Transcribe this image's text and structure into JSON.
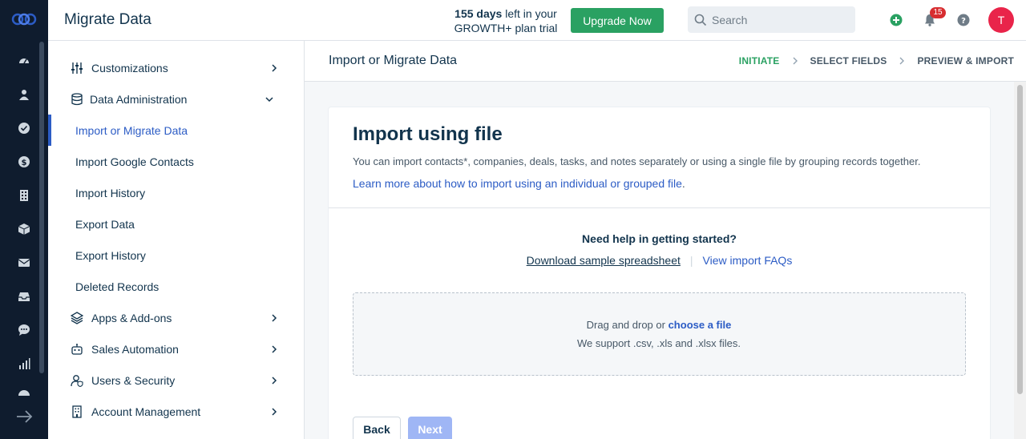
{
  "topbar": {
    "title": "Migrate Data",
    "trial_days": "155 days",
    "trial_line1_rest": " left in your",
    "trial_line2": "GROWTH+ plan trial",
    "upgrade_label": "Upgrade Now",
    "search_placeholder": "Search",
    "notification_count": "15",
    "avatar_initial": "T"
  },
  "rail": {
    "icons": [
      "dashboard-icon",
      "contacts-icon",
      "tasks-icon",
      "deals-icon",
      "companies-icon",
      "products-icon",
      "email-icon",
      "inbox-icon",
      "chat-icon",
      "reports-icon"
    ]
  },
  "sidebar": {
    "items": [
      {
        "label": "Customizations",
        "icon": "sliders-icon"
      },
      {
        "label": "Data Administration",
        "icon": "database-icon"
      },
      {
        "label": "Import or Migrate Data"
      },
      {
        "label": "Import Google Contacts"
      },
      {
        "label": "Import History"
      },
      {
        "label": "Export Data"
      },
      {
        "label": "Export History"
      },
      {
        "label": "Deleted Records"
      },
      {
        "label": "Apps & Add-ons",
        "icon": "layers-icon"
      },
      {
        "label": "Sales Automation",
        "icon": "robot-icon"
      },
      {
        "label": "Users & Security",
        "icon": "user-shield-icon"
      },
      {
        "label": "Account Management",
        "icon": "building-icon"
      }
    ]
  },
  "content": {
    "header_title": "Import or Migrate Data",
    "steps": [
      "INITIATE",
      "SELECT FIELDS",
      "PREVIEW & IMPORT"
    ],
    "current_step": "INITIATE"
  },
  "card": {
    "title": "Import using file",
    "description": "You can import contacts*, companies, deals, tasks, and notes separately or using a single file by grouping records together.",
    "learn_more": "Learn more about how to import using an individual or grouped file",
    "learn_more_end": ".",
    "help_title": "Need help in getting started?",
    "download_link": "Download sample spreadsheet",
    "separator": "|",
    "faq_link": "View import FAQs",
    "drop_text": "Drag and drop or ",
    "choose_file": "choose a file",
    "support_text": "We support .csv, .xls and .xlsx files.",
    "back_label": "Back",
    "next_label": "Next"
  },
  "colors": {
    "rail_bg": "#0f1c2e",
    "accent_blue": "#2c5cc5",
    "upgrade_green": "#2aa162",
    "next_disabled": "#9fb6f5",
    "badge_red": "#d72d30",
    "avatar_pink": "#e9244a"
  }
}
